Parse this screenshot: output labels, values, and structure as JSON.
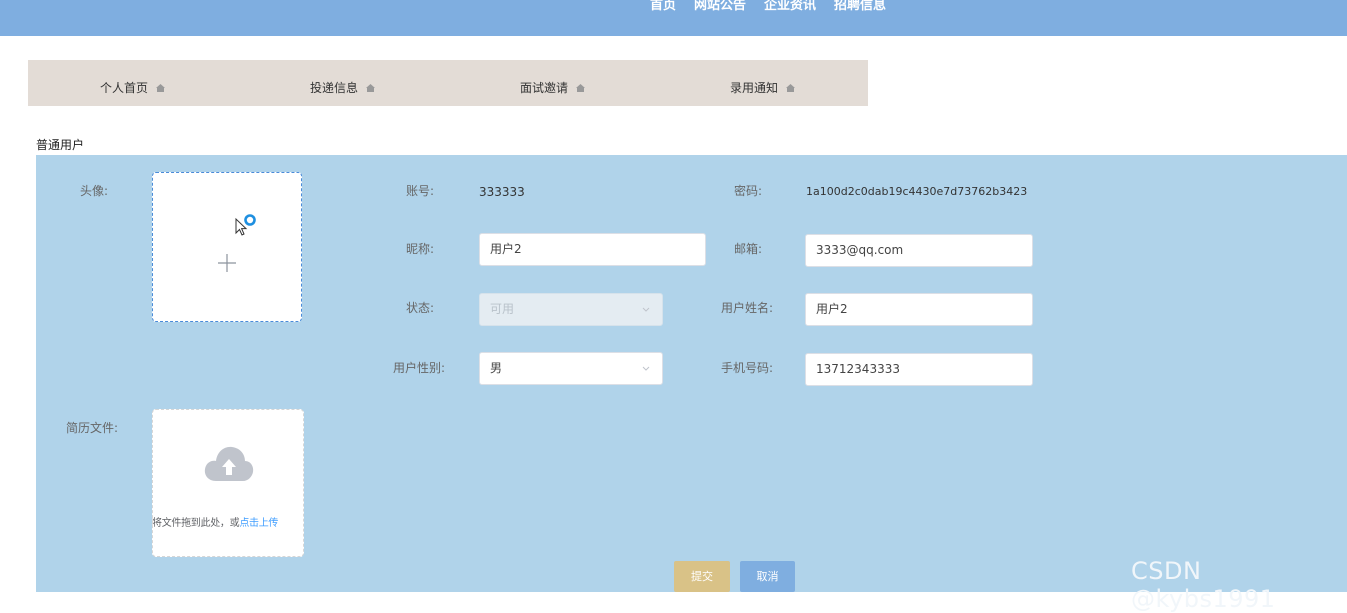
{
  "topnav": {
    "items": [
      "首页",
      "网站公告",
      "企业资讯",
      "招聘信息"
    ]
  },
  "tabs": [
    {
      "label": "个人首页",
      "icon": "home-icon"
    },
    {
      "label": "投递信息",
      "icon": "home-icon"
    },
    {
      "label": "面试邀请",
      "icon": "home-icon"
    },
    {
      "label": "录用通知",
      "icon": "home-icon"
    }
  ],
  "section_title": "普通用户",
  "form": {
    "avatar_label": "头像:",
    "account_label": "账号:",
    "account_value": "333333",
    "password_label": "密码:",
    "password_value": "1a100d2c0dab19c4430e7d73762b3423",
    "nickname_label": "昵称:",
    "nickname_value": "用户2",
    "email_label": "邮箱:",
    "email_value": "3333@qq.com",
    "status_label": "状态:",
    "status_value": "可用",
    "realname_label": "用户姓名:",
    "realname_value": "用户2",
    "gender_label": "用户性别:",
    "gender_value": "男",
    "phone_label": "手机号码:",
    "phone_value": "13712343333",
    "resume_label": "简历文件:",
    "resume_hint": "将文件拖到此处，或",
    "resume_link": "点击上传"
  },
  "buttons": {
    "submit": "提交",
    "cancel": "取消"
  },
  "watermark": "CSDN @kybs1991",
  "colors": {
    "topbar": "#7faee0",
    "tabbar": "#e3dcd6",
    "panel": "#b0d3ea",
    "submit": "#d9c287",
    "cancel": "#7faee0",
    "link": "#409eff"
  }
}
